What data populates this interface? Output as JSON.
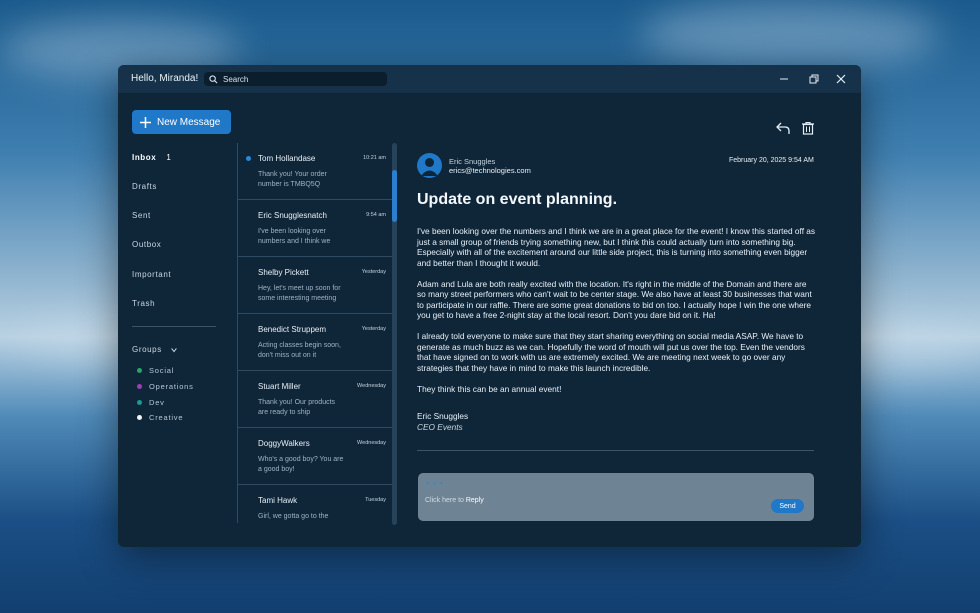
{
  "app": {
    "greeting": "Hello, Miranda!"
  },
  "search": {
    "placeholder": "Search"
  },
  "toolbar": {
    "new_message_label": "New Message"
  },
  "folders": [
    {
      "label": "Inbox",
      "count": "1"
    },
    {
      "label": "Drafts"
    },
    {
      "label": "Sent"
    },
    {
      "label": "Outbox"
    },
    {
      "label": "Important"
    },
    {
      "label": "Trash"
    }
  ],
  "groups": {
    "label": "Groups",
    "items": [
      {
        "label": "Social",
        "color": "#2aa36b"
      },
      {
        "label": "Operations",
        "color": "#9b3fb8"
      },
      {
        "label": "Dev",
        "color": "#1b9a8f"
      },
      {
        "label": "Creative",
        "color": "#f0f4f7"
      }
    ]
  },
  "messages": [
    {
      "sender": "Tom Hollandase",
      "time": "10:21 am",
      "preview": "Thank you! Your order number is TMBQ5Q",
      "unread": true
    },
    {
      "sender": "Eric Snugglesnatch",
      "time": "9:54 am",
      "preview": "I've been looking over numbers and I think we"
    },
    {
      "sender": "Shelby Pickett",
      "time": "Yesterday",
      "preview": "Hey, let's meet up soon for some interesting meeting"
    },
    {
      "sender": "Benedict Struppem",
      "time": "Yesterday",
      "preview": "Acting classes begin soon, don't miss out on it"
    },
    {
      "sender": "Stuart Miller",
      "time": "Wednesday",
      "preview": "Thank you! Our products are ready to ship"
    },
    {
      "sender": "DoggyWalkers",
      "time": "Wednesday",
      "preview": "Who's a good boy? You are a good boy!"
    },
    {
      "sender": "Tami Hawk",
      "time": "Tuesday",
      "preview": "Girl, we gotta go to the movies soon! When are you"
    }
  ],
  "reader": {
    "from_name": "Eric Snuggles",
    "from_email": "erics@technologies.com",
    "date": "February 20, 2025  9:54 AM",
    "subject": "Update on event planning.",
    "paragraphs": [
      "I've been looking over the numbers and I think we are in a great place for the event! I know this started off as just a small group of friends trying something new, but I think this could actually turn into something big. Especially with all of the excitement around our little side project, this is turning into something even bigger and better than I thought it would.",
      "Adam and Lula are both really excited with the location. It's right in the middle of the Domain and there are so many street performers who can't wait to be center stage. We also have at least 30 businesses that want to participate in our raffle. There are some great donations to bid on too. I actually hope I win the one where you get to have a free 2-night stay at the local resort. Don't you dare bid on it. Ha!",
      "I already told everyone to make sure that they start sharing everything on social media ASAP. We have to generate as much buzz as we can. Hopefully the word of mouth will put us over the top. Even the vendors that have signed on to work with us are extremely excited. We are meeting next week to go over any strategies that they have in mind to make this launch incredible.",
      "They think this can be an annual event!"
    ],
    "signature_name": "Eric Snuggles",
    "signature_title": "CEO Events"
  },
  "reply": {
    "dots": "• • •",
    "placeholder_prefix": "Click here to ",
    "placeholder_action": "Reply",
    "send_label": "Send"
  },
  "colors": {
    "accent": "#1f78c8",
    "window_bg": "#0f2639",
    "titlebar_bg": "#15324a"
  }
}
